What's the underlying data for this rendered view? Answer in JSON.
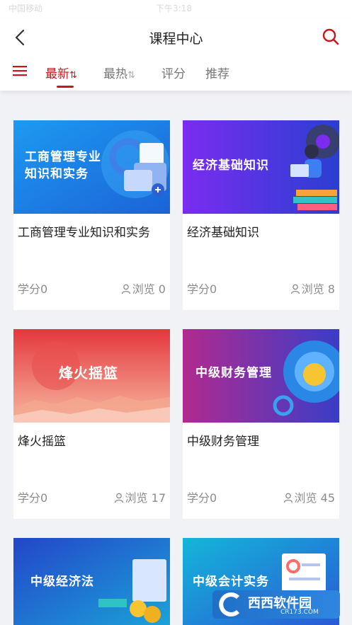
{
  "status_bar": {
    "time": "下午3:18",
    "carrier": "中国移动"
  },
  "header": {
    "title": "课程中心",
    "tabs": [
      "最新",
      "最热",
      "评分",
      "推荐"
    ],
    "sort_glyph": "⇅"
  },
  "courses": [
    {
      "cover_title": "工商管理专业\n知识和实务",
      "title": "工商管理专业知识和实务",
      "credit": "学分0",
      "views": "浏览 0"
    },
    {
      "cover_title": "经济基础知识",
      "title": "经济基础知识",
      "credit": "学分0",
      "views": "浏览 8"
    },
    {
      "cover_title": "烽火摇篮",
      "title": "烽火摇篮",
      "credit": "学分0",
      "views": "浏览 17"
    },
    {
      "cover_title": "中级财务管理",
      "title": "中级财务管理",
      "credit": "学分0",
      "views": "浏览 45"
    },
    {
      "cover_title": "中级经济法",
      "title": "",
      "credit": "",
      "views": ""
    },
    {
      "cover_title": "中级会计实务",
      "title": "",
      "credit": "",
      "views": ""
    }
  ],
  "watermark": {
    "brand": "西西软件园",
    "url": "CR173.COM"
  },
  "icons": {
    "back": "chevron-left-icon",
    "search": "search-icon",
    "menu": "hamburger-icon",
    "user": "user-icon"
  },
  "colors": {
    "accent": "#c8161d",
    "muted": "#8c8c8c",
    "background": "#f1f2f5"
  }
}
